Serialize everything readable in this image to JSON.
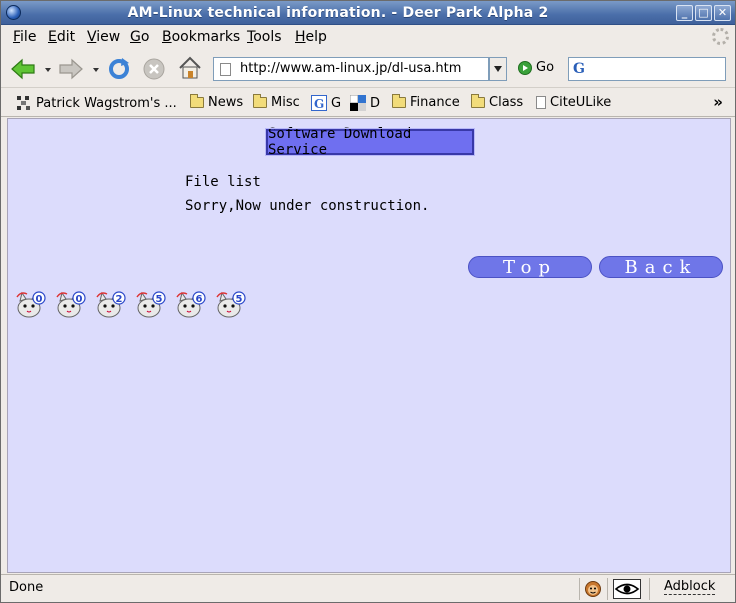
{
  "window": {
    "title": "AM-Linux technical information. - Deer Park Alpha 2"
  },
  "menu": {
    "items": [
      {
        "label": "File",
        "u": "F",
        "rest": "ile"
      },
      {
        "label": "Edit",
        "u": "E",
        "rest": "dit"
      },
      {
        "label": "View",
        "u": "V",
        "rest": "iew"
      },
      {
        "label": "Go",
        "u": "G",
        "rest": "o"
      },
      {
        "label": "Bookmarks",
        "u": "B",
        "rest": "ookmarks"
      },
      {
        "label": "Tools",
        "u": "T",
        "rest": "ools"
      },
      {
        "label": "Help",
        "u": "H",
        "rest": "elp"
      }
    ]
  },
  "navbar": {
    "url": "http://www.am-linux.jp/dl-usa.htm",
    "go_label": "Go",
    "search_engine_icon": "G"
  },
  "bookmarks": {
    "items": [
      {
        "label": "Patrick Wagstrom's ...",
        "icon": "favicon"
      },
      {
        "label": "News",
        "icon": "folder"
      },
      {
        "label": "Misc",
        "icon": "folder"
      },
      {
        "label": "G",
        "icon": "google-favicon"
      },
      {
        "label": "D",
        "icon": "delicious-favicon"
      },
      {
        "label": "Finance",
        "icon": "folder"
      },
      {
        "label": "Class",
        "icon": "folder"
      },
      {
        "label": "CiteULike",
        "icon": "page"
      }
    ],
    "more": "»"
  },
  "page": {
    "heading": "Software Download Service",
    "file_list": "File list",
    "message": "Sorry,Now under construction.",
    "top_button": "Top",
    "back_button": "Back",
    "counter_digits": [
      "0",
      "0",
      "2",
      "5",
      "6",
      "5"
    ]
  },
  "status": {
    "text": "Done",
    "adblock": "Adblock"
  },
  "colors": {
    "content_bg": "#dcdcfc",
    "heading_bg": "#6f6ff0",
    "pill_bg": "#6f76e8"
  }
}
